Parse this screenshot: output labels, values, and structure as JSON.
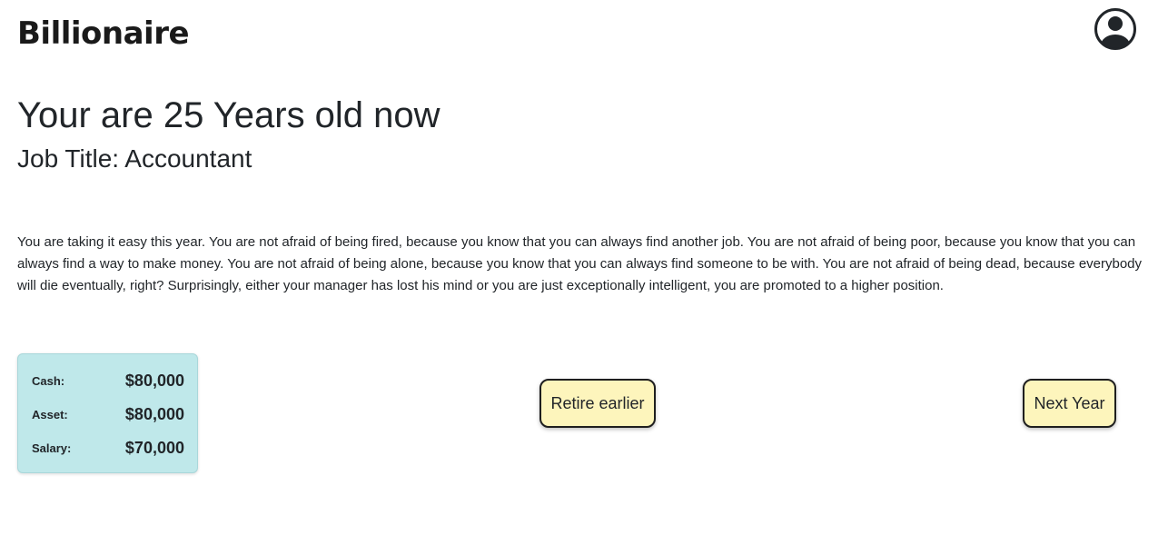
{
  "header": {
    "brand": "Billionaire",
    "profile_icon": "user-circle-icon"
  },
  "main": {
    "age_heading": "Your are 25 Years old now",
    "job_heading": "Job Title: Accountant",
    "story": "You are taking it easy this year. You are not afraid of being fired, because you know that you can always find another job. You are not afraid of being poor, because you know that you can always find a way to make money. You are not afraid of being alone, because you know that you can always find someone to be with. You are not afraid of being dead, because everybody will die eventually, right? Surprisingly, either your manager has lost his mind or you are just exceptionally intelligent, you are promoted to a higher position."
  },
  "stats": {
    "cash_label": "Cash:",
    "cash_value": "$80,000",
    "asset_label": "Asset:",
    "asset_value": "$80,000",
    "salary_label": "Salary:",
    "salary_value": "$70,000"
  },
  "actions": {
    "retire_label": "Retire earlier",
    "next_label": "Next Year"
  },
  "colors": {
    "stats_card_bg": "#bfe8ea",
    "button_bg": "#fdf5bc"
  }
}
